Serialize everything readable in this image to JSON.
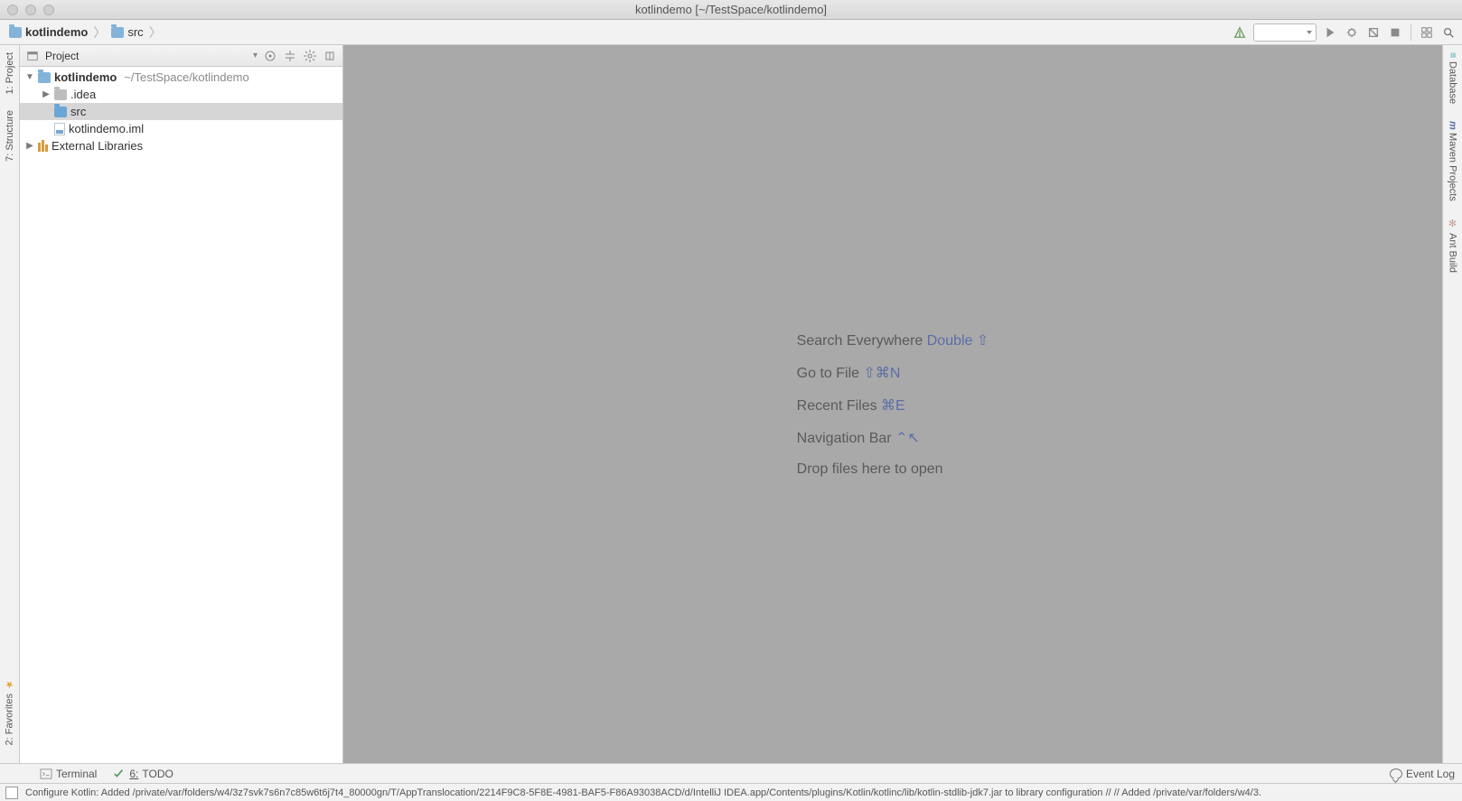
{
  "window": {
    "title": "kotlindemo [~/TestSpace/kotlindemo]"
  },
  "breadcrumbs": {
    "project": "kotlindemo",
    "folder": "src"
  },
  "toolbar_right": {
    "run_config": ""
  },
  "left_tabs": {
    "project": "1: Project",
    "structure": "7: Structure",
    "favorites": "2: Favorites"
  },
  "right_tabs": {
    "database": "Database",
    "maven": "Maven Projects",
    "ant": "Ant Build"
  },
  "project_panel": {
    "title": "Project",
    "tree": {
      "root_name": "kotlindemo",
      "root_path": "~/TestSpace/kotlindemo",
      "idea": ".idea",
      "src": "src",
      "iml": "kotlindemo.iml",
      "ext_lib": "External Libraries"
    }
  },
  "editor_hints": {
    "search_label": "Search Everywhere",
    "search_key": "Double ⇧",
    "goto_label": "Go to File",
    "goto_key": "⇧⌘N",
    "recent_label": "Recent Files",
    "recent_key": "⌘E",
    "nav_label": "Navigation Bar",
    "nav_key": "⌃↖",
    "drop_label": "Drop files here to open"
  },
  "bottom_tools": {
    "terminal": "Terminal",
    "todo_num": "6:",
    "todo": "TODO",
    "event_log": "Event Log"
  },
  "status": {
    "message": "Configure Kotlin: Added /private/var/folders/w4/3z7svk7s6n7c85w6t6j7t4_80000gn/T/AppTranslocation/2214F9C8-5F8E-4981-BAF5-F86A93038ACD/d/IntelliJ IDEA.app/Contents/plugins/Kotlin/kotlinc/lib/kotlin-stdlib-jdk7.jar to library configuration // // Added /private/var/folders/w4/3."
  }
}
